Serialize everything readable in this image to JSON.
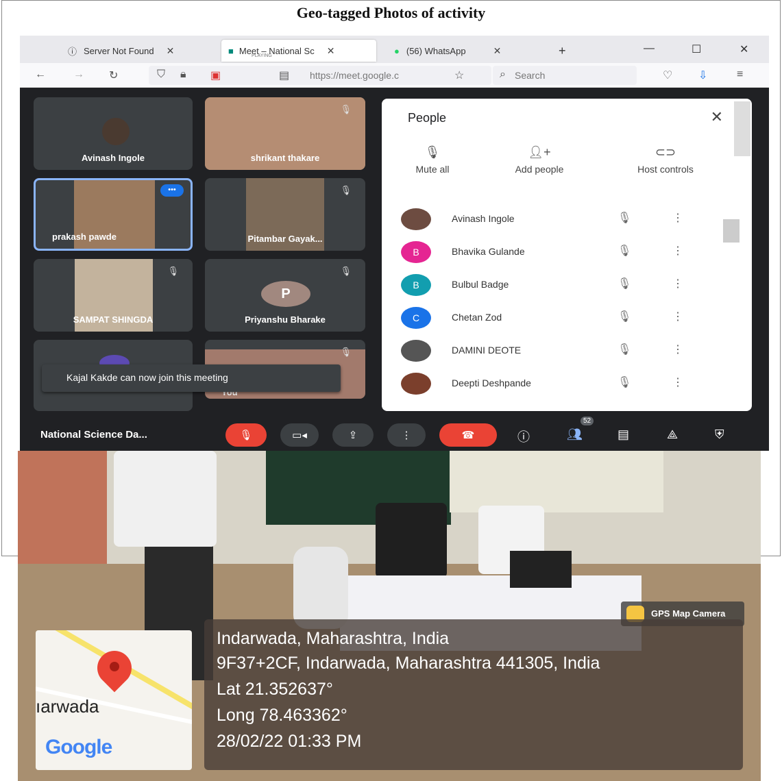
{
  "doc": {
    "title": "Geo-tagged Photos of activity"
  },
  "browser": {
    "tabs": [
      {
        "label": "Server Not Found"
      },
      {
        "label": "Meet – National Sc",
        "sub": "PLAYING"
      },
      {
        "label": "(56) WhatsApp"
      }
    ],
    "new_tab": "+",
    "url": "https://meet.google.c",
    "search_placeholder": "Search"
  },
  "meet": {
    "tiles": [
      {
        "name": "Avinash Ingole"
      },
      {
        "name": "shrikant thakare"
      },
      {
        "name": "prakash pawde"
      },
      {
        "name": "Pitambar Gayak..."
      },
      {
        "name": "SAMPAT SHINGDA"
      },
      {
        "name": "Priyanshu Bharake",
        "initial": "P"
      },
      {
        "name": "You"
      }
    ],
    "more_label": "•••",
    "toast": "Kajal Kakde can now join this meeting",
    "meeting_name": "National Science Da...",
    "participant_count": "52",
    "people_panel": {
      "title": "People",
      "actions": [
        "Mute all",
        "Add people",
        "Host controls"
      ],
      "participants": [
        {
          "name": "Avinash Ingole",
          "color": "#6d4c41"
        },
        {
          "name": "Bhavika Gulande",
          "initial": "B",
          "color": "#e52592"
        },
        {
          "name": "Bulbul Badge",
          "initial": "B",
          "color": "#129eaf"
        },
        {
          "name": "Chetan Zod",
          "initial": "C",
          "color": "#1a73e8"
        },
        {
          "name": "DAMINI DEOTE",
          "color": "#555555"
        },
        {
          "name": "Deepti Deshpande",
          "color": "#7b3f2c"
        }
      ]
    }
  },
  "gps": {
    "camera_label": "GPS Map Camera",
    "place": "Indarwada, Maharashtra, India",
    "address": "9F37+2CF, Indarwada, Maharashtra 441305, India",
    "lat": "Lat 21.352637°",
    "long": "Long 78.463362°",
    "datetime": "28/02/22 01:33 PM",
    "map_label": "ıarwada",
    "map_brand": "Google"
  }
}
